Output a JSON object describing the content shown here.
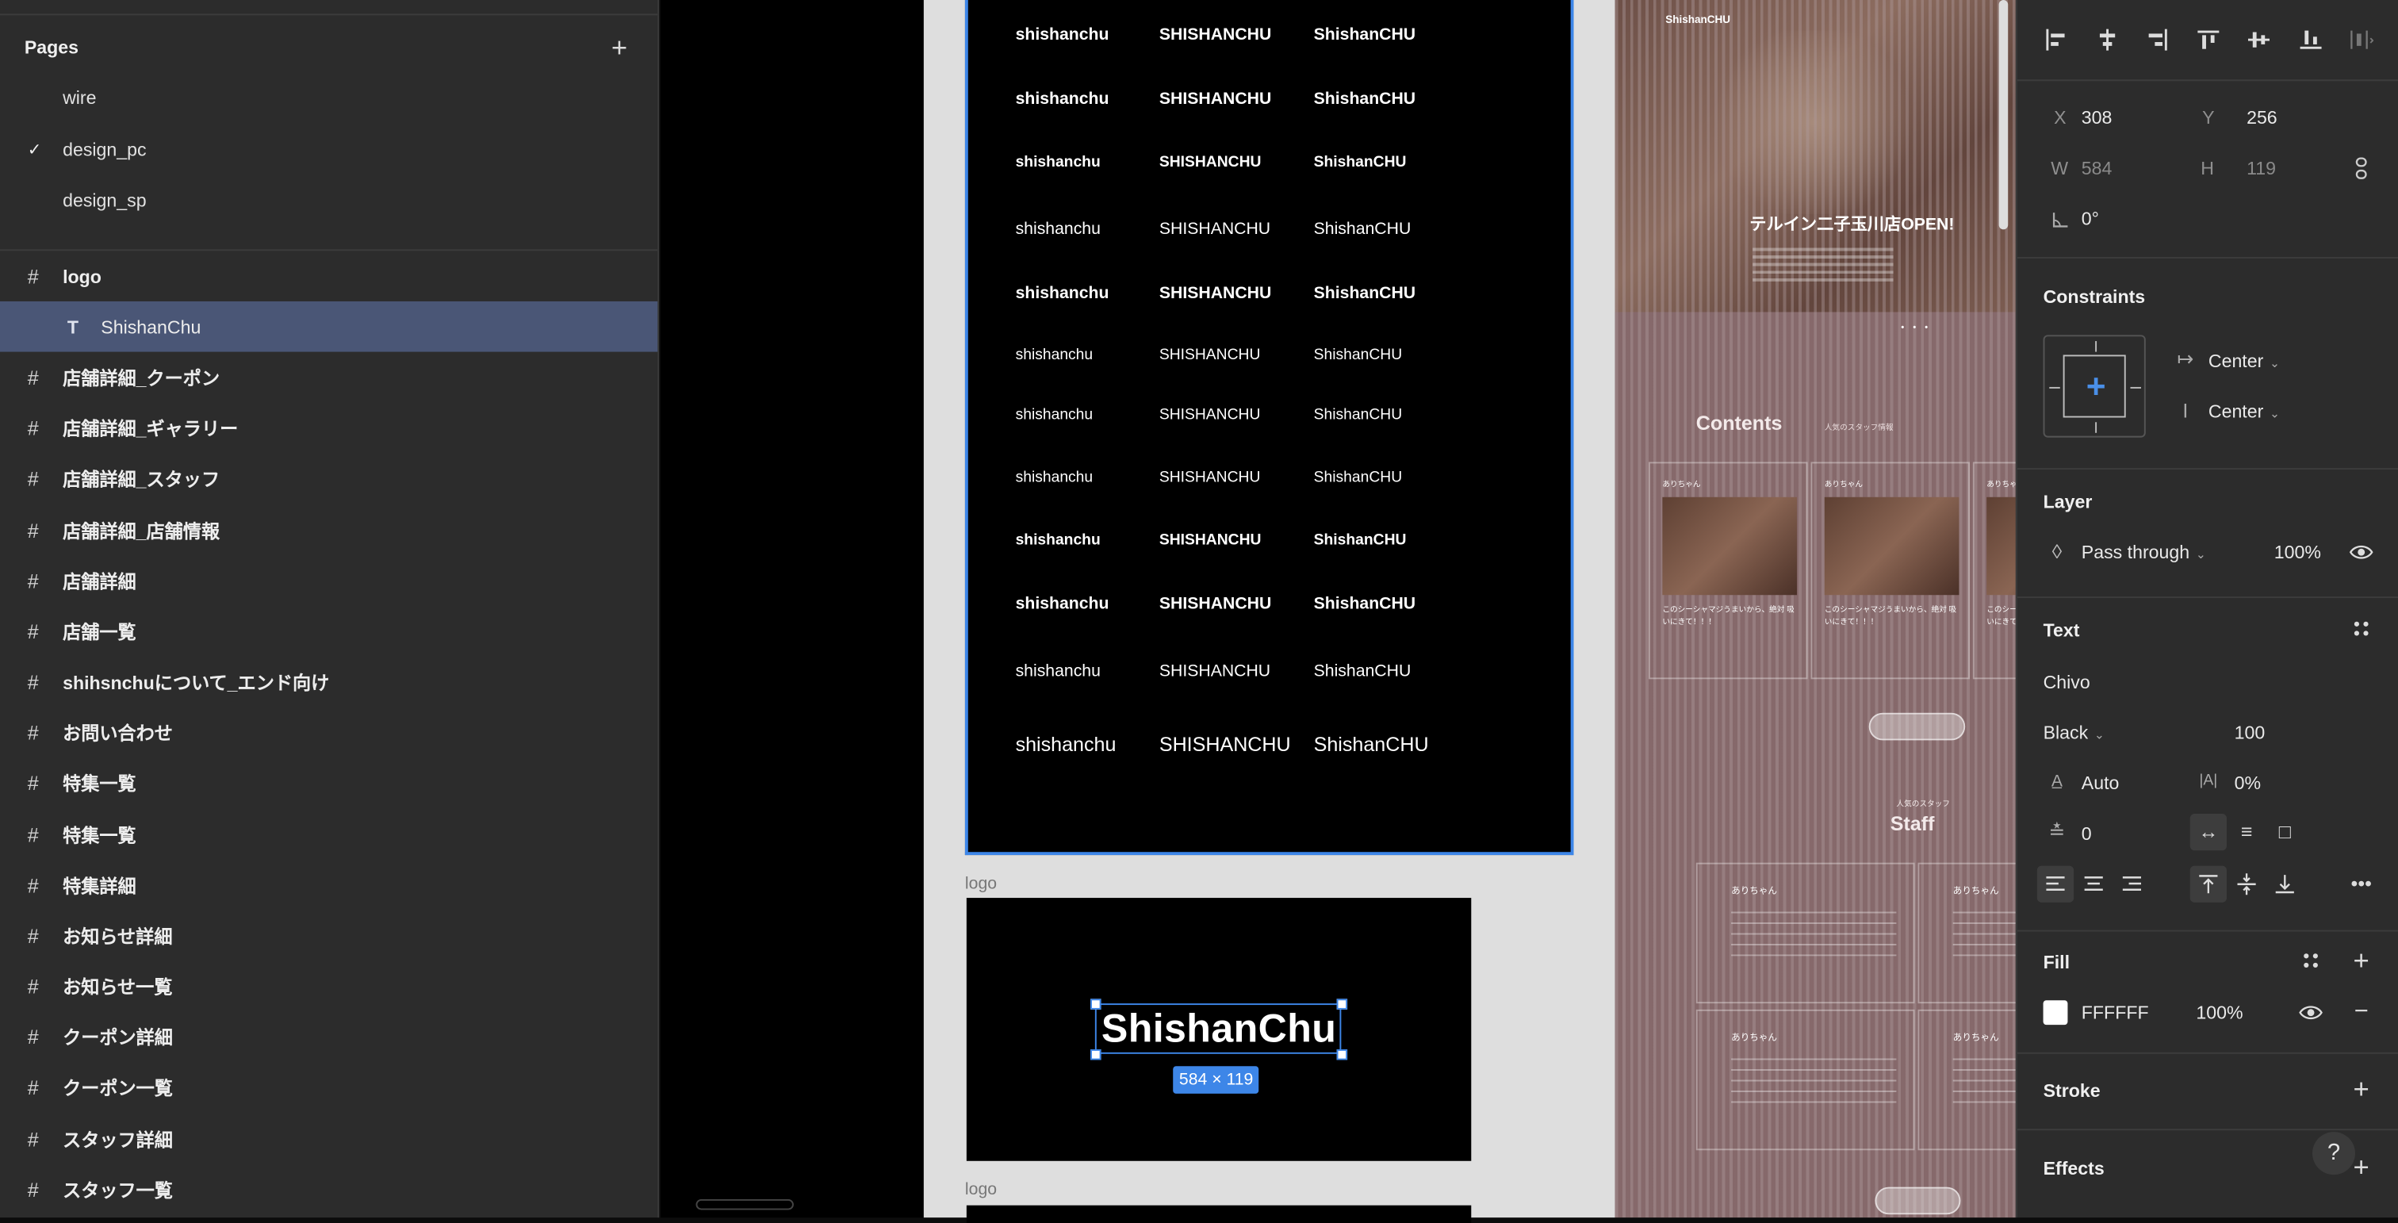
{
  "pages": {
    "title": "Pages",
    "add": "+",
    "items": [
      {
        "label": "wire",
        "checked": false
      },
      {
        "label": "design_pc",
        "checked": true
      },
      {
        "label": "design_sp",
        "checked": false
      }
    ],
    "check_glyph": "✓"
  },
  "layers": {
    "logo_frame": "logo",
    "selected_text_layer": "ShishanChu",
    "frames": [
      "店舗詳細_クーポン",
      "店舗詳細_ギャラリー",
      "店舗詳細_スタッフ",
      "店舗詳細_店舗情報",
      "店舗詳細",
      "店舗一覧",
      "shihsnchuについて_エンド向け",
      "お問い合わせ",
      "特集一覧",
      "特集一覧",
      "特集詳細",
      "お知らせ詳細",
      "お知らせ一覧",
      "クーポン詳細",
      "クーポン一覧",
      "スタッフ詳細",
      "スタッフ一覧"
    ],
    "hash_glyph": "#",
    "text_glyph": "T"
  },
  "canvas": {
    "font_rows": [
      {
        "a": "shishanchu",
        "b": "SHISHANCHU",
        "c": "ShishanCHU",
        "weight": 800
      },
      {
        "a": "shishanchu",
        "b": "SHISHANCHU",
        "c": "ShishanCHU",
        "weight": 700
      },
      {
        "a": "shishanchu",
        "b": "SHISHANCHU",
        "c": "ShishanCHU",
        "weight": 700
      },
      {
        "a": "shishanchu",
        "b": "SHISHANCHU",
        "c": "ShishanCHU",
        "weight": 400
      },
      {
        "a": "shishanchu",
        "b": "SHISHANCHU",
        "c": "ShishanCHU",
        "weight": 600
      },
      {
        "a": "shishanchu",
        "b": "SHISHANCHU",
        "c": "ShishanCHU",
        "weight": 300
      },
      {
        "a": "shishanchu",
        "b": "SHISHANCHU",
        "c": "ShishanCHU",
        "weight": 500
      },
      {
        "a": "shishanchu",
        "b": "SHISHANCHU",
        "c": "ShishanCHU",
        "weight": 500
      },
      {
        "a": "shishanchu",
        "b": "SHISHANCHU",
        "c": "ShishanCHU",
        "weight": 800
      },
      {
        "a": "shishanchu",
        "b": "SHISHANCHU",
        "c": "ShishanCHU",
        "weight": 900
      },
      {
        "a": "shishanchu",
        "b": "SHISHANCHU",
        "c": "ShishanCHU",
        "weight": 500
      },
      {
        "a": "shishanchu",
        "b": "SHISHANCHU",
        "c": "ShishanCHU",
        "weight": 300
      }
    ],
    "logo_frame_label": "logo",
    "logo_text": "ShishanChu",
    "dimension_badge": "584 × 119",
    "logo_frame2_label": "logo",
    "preview": {
      "site_logo": "ShishanCHU",
      "hero_title": "テルイン二子玉川店OPEN!",
      "dots": "• • •",
      "contents_title": "Contents",
      "contents_sub": "人気のスタッフ情報",
      "card_name": "ありちゃん",
      "card_text": "このシーシャマジうまいから、絶対 吸いにきて！！！",
      "staff_sub": "人気のスタッフ",
      "staff_title": "Staff",
      "staff_name": "ありちゃん"
    }
  },
  "inspector": {
    "position": {
      "x_label": "X",
      "x": "308",
      "y_label": "Y",
      "y": "256"
    },
    "size": {
      "w_label": "W",
      "w": "584",
      "h_label": "H",
      "h": "119"
    },
    "rotation": {
      "value": "0°"
    },
    "constraints": {
      "title": "Constraints",
      "horizontal": "Center",
      "vertical": "Center"
    },
    "layer": {
      "title": "Layer",
      "blend": "Pass through",
      "opacity": "100%"
    },
    "text": {
      "title": "Text",
      "font_family": "Chivo",
      "font_style": "Black",
      "font_size": "100",
      "line_height": "Auto",
      "letter_spacing": "0%",
      "paragraph_spacing": "0"
    },
    "fill": {
      "title": "Fill",
      "color_hex": "FFFFFF",
      "opacity": "100%",
      "color": "#FFFFFF"
    },
    "stroke": {
      "title": "Stroke"
    },
    "effects": {
      "title": "Effects"
    },
    "help": "?"
  },
  "colors": {
    "selection": "#3d86e8",
    "panel_bg": "#2c2c2c",
    "selected_layer_bg": "#4a5676"
  }
}
